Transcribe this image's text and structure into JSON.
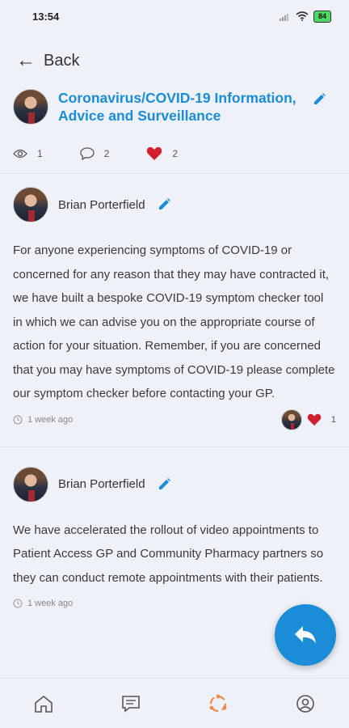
{
  "status": {
    "time": "13:54",
    "battery": "84"
  },
  "nav": {
    "back_label": "Back"
  },
  "topic": {
    "title": "Coronavirus/COVID-19 Information, Advice and Surveillance",
    "views": "1",
    "comments": "2",
    "likes": "2"
  },
  "posts": [
    {
      "author": "Brian Porterfield",
      "body": "For anyone experiencing symptoms of COVID-19 or concerned for any reason that they may have contracted it, we have built a bespoke COVID-19 symptom checker tool in which we can advise you on the appropriate course of action for your situation. Remember, if you are concerned that you may have symptoms of COVID-19 please complete our symptom checker before contacting your GP.",
      "time": "1 week ago",
      "likes": "1"
    },
    {
      "author": "Brian Porterfield",
      "body": "We have accelerated the rollout of video appointments to Patient Access GP and Community Pharmacy partners so they can conduct remote appointments with their patients.",
      "time": "1 week ago"
    }
  ],
  "bottom_nav": [
    "home-icon",
    "chat-icon",
    "community-icon",
    "profile-icon"
  ],
  "colors": {
    "accent": "#1a8cd8",
    "like": "#d0202e",
    "background": "#eef2f8"
  }
}
